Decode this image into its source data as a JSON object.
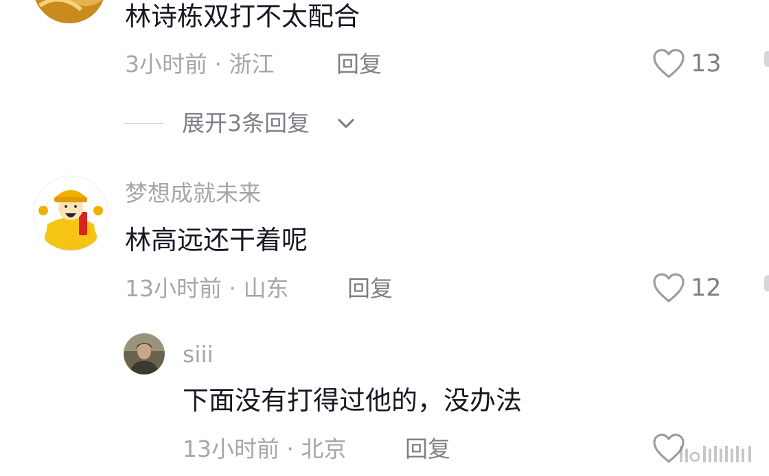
{
  "comments": [
    {
      "id": "c1",
      "text": "林诗栋双打不太配合",
      "meta": "3小时前 · 浙江",
      "reply_label": "回复",
      "likes": "13",
      "expand": "展开3条回复"
    },
    {
      "id": "c2",
      "username": "梦想成就未来",
      "text": "林高远还干着呢",
      "meta": "13小时前 · 山东",
      "reply_label": "回复",
      "likes": "12"
    }
  ],
  "reply": {
    "username": "siii",
    "text": "下面没有打得过他的，没办法",
    "meta": "13小时前 · 北京",
    "reply_label": "回复"
  },
  "icons": {
    "like": "heart-outline-icon",
    "expand": "chevron-down-icon"
  },
  "colors": {
    "text": "#161823",
    "meta": "#a4a6ab",
    "action": "#7d7f86"
  }
}
